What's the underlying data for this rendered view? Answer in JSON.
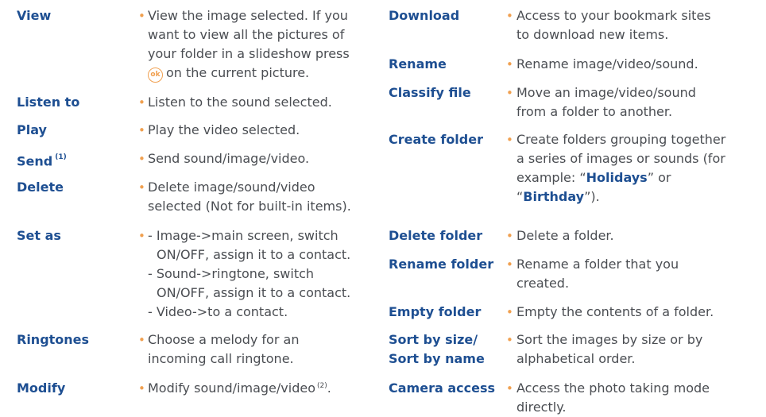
{
  "left_entries": [
    {
      "term": "View",
      "lines": [
        "View the image selected. If you",
        "want to view all the pictures of",
        "your folder in a slideshow press",
        "on the current picture."
      ]
    },
    {
      "term": "Listen to",
      "lines": [
        "Listen to the sound selected."
      ]
    },
    {
      "term": "Play",
      "lines": [
        "Play the video selected."
      ]
    },
    {
      "term": "Send",
      "term_note": "(1)",
      "lines": [
        "Send sound/image/video."
      ]
    },
    {
      "term": "Delete",
      "lines": [
        "Delete image/sound/video",
        "selected (Not for built-in items)."
      ]
    },
    {
      "term": "Set as",
      "lines": [
        "- Image->main screen, switch",
        "ON/OFF, assign it to a contact.",
        "- Sound->ringtone, switch",
        "ON/OFF, assign it to a contact.",
        "- Video->to a contact."
      ]
    },
    {
      "term": "Ringtones",
      "lines": [
        "Choose a melody for an",
        "incoming call ringtone."
      ]
    },
    {
      "term": "Modify",
      "lines": [
        "Modify sound/image/video"
      ],
      "note": "(2)",
      "tail": "."
    }
  ],
  "ok_key_label": "ok",
  "right_entries": [
    {
      "term": "Download",
      "lines": [
        "Access to your bookmark sites",
        "to download new items."
      ]
    },
    {
      "term": "Rename",
      "lines": [
        "Rename image/video/sound."
      ]
    },
    {
      "term": "Classify file",
      "lines": [
        "Move an image/video/sound",
        "from a folder to another."
      ]
    },
    {
      "term": "Create folder",
      "lines": [
        "Create folders grouping together",
        "a series of images or sounds (for",
        "example: “",
        "Holidays",
        "” or",
        "“",
        "Birthday",
        "”)."
      ]
    },
    {
      "term": "Delete folder",
      "lines": [
        "Delete a folder."
      ]
    },
    {
      "term": "Rename folder",
      "lines": [
        "Rename a folder that you",
        "created."
      ]
    },
    {
      "term": "Empty folder",
      "lines": [
        "Empty the contents of a folder."
      ]
    },
    {
      "term": "Sort by size/",
      "term2": "Sort by name",
      "lines": [
        "Sort the images by size or by",
        "alphabetical order."
      ]
    },
    {
      "term": "Camera access",
      "lines": [
        "Access the photo taking mode",
        "directly."
      ]
    }
  ]
}
